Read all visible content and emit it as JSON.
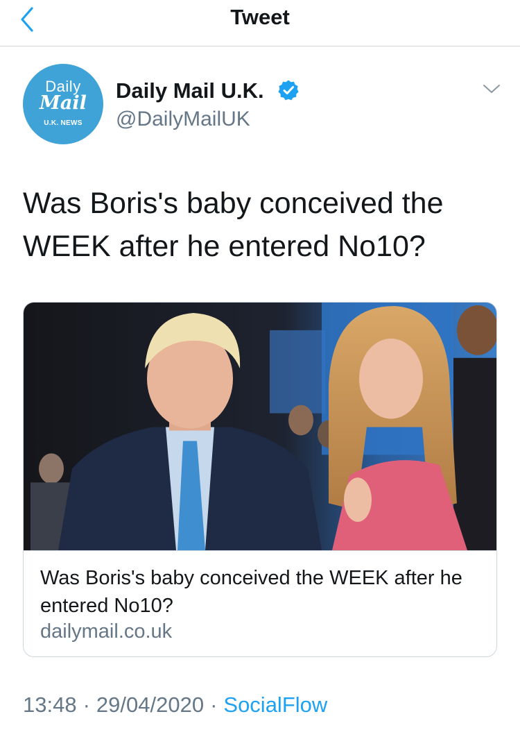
{
  "nav": {
    "title": "Tweet",
    "back_icon": "chevron-left-icon"
  },
  "author": {
    "display_name": "Daily Mail U.K.",
    "handle": "@DailyMailUK",
    "verified": true,
    "avatar": {
      "line1": "Daily",
      "line2": "Mail",
      "line3": "U.K. NEWS",
      "bg_color": "#3fa3d8"
    }
  },
  "tweet": {
    "text": "Was Boris's baby conceived the WEEK after he entered No10?"
  },
  "card": {
    "title": "Was Boris's baby conceived the WEEK after he entered No10?",
    "domain": "dailymail.co.uk"
  },
  "meta": {
    "time": "13:48",
    "date": "29/04/2020",
    "source": "SocialFlow",
    "separator": "·"
  },
  "colors": {
    "accent": "#1da1f2",
    "secondary_text": "#657786",
    "primary_text": "#14171a",
    "border": "#ccd6dd"
  }
}
